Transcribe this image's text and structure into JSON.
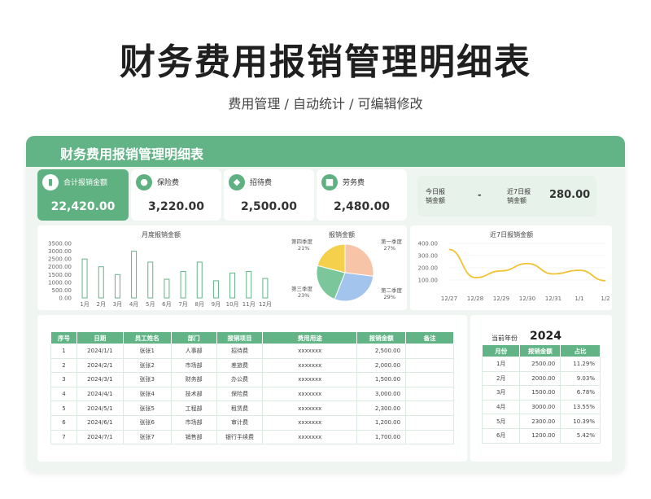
{
  "page": {
    "title": "财务费用报销管理明细表",
    "subtitle": "费用管理 / 自动统计 / 可编辑修改"
  },
  "card": {
    "title": "财务费用报销管理明细表"
  },
  "kpis": [
    {
      "label": "合计报销金额",
      "value": "22,420.00",
      "icon": "bar-chart-icon"
    },
    {
      "label": "保险费",
      "value": "3,220.00",
      "icon": "user-icon"
    },
    {
      "label": "招待费",
      "value": "2,500.00",
      "icon": "handshake-icon"
    },
    {
      "label": "劳务费",
      "value": "2,480.00",
      "icon": "document-icon"
    }
  ],
  "today": {
    "today_label": "今日报销金额",
    "today_value": "-",
    "week_label": "近7日报销金额",
    "week_value": "280.00"
  },
  "monthly_chart_title": "月度报销金额",
  "pie_chart_title": "报销金额",
  "week_chart_title": "近7日报销金额",
  "colors": {
    "accent": "#62b487",
    "pie_q1": "#f8c4a8",
    "pie_q2": "#a3c4ec",
    "pie_q3": "#7bc79b",
    "pie_q4": "#f5d04c",
    "line": "#f1c232"
  },
  "chart_data": [
    {
      "type": "bar",
      "title": "月度报销金额",
      "categories": [
        "1月",
        "2月",
        "3月",
        "4月",
        "5月",
        "6月",
        "7月",
        "8月",
        "9月",
        "10月",
        "11月",
        "12月"
      ],
      "values": [
        2500,
        2000,
        1500,
        3000,
        2300,
        1200,
        1700,
        2300,
        1100,
        1600,
        1700,
        1250
      ],
      "yticks": [
        "0.00",
        "500.00",
        "1000.00",
        "1500.00",
        "2000.00",
        "2500.00",
        "3000.00",
        "3500.00"
      ],
      "ylim": [
        0,
        3500
      ]
    },
    {
      "type": "pie",
      "title": "报销金额",
      "slices": [
        {
          "name": "第一季度",
          "percent": 27,
          "label": "27%"
        },
        {
          "name": "第二季度",
          "percent": 29,
          "label": "29%"
        },
        {
          "name": "第三季度",
          "percent": 23,
          "label": "23%"
        },
        {
          "name": "第四季度",
          "percent": 21,
          "label": "21%"
        }
      ]
    },
    {
      "type": "line",
      "title": "近7日报销金额",
      "categories": [
        "12/27",
        "12/28",
        "12/29",
        "12/30",
        "12/31",
        "1/1",
        "1/2"
      ],
      "values": [
        350,
        120,
        175,
        235,
        150,
        180,
        95
      ],
      "yticks": [
        "100.00",
        "200.00",
        "300.00",
        "400.00"
      ],
      "ylim": [
        0,
        400
      ]
    }
  ],
  "detail_table": {
    "headers": [
      "序号",
      "日期",
      "员工姓名",
      "部门",
      "报销项目",
      "费用用途",
      "报销金额",
      "备注"
    ],
    "rows": [
      [
        "1",
        "2024/1/1",
        "张张1",
        "人事部",
        "招待费",
        "xxxxxxx",
        "2,500.00",
        ""
      ],
      [
        "2",
        "2024/2/1",
        "张张2",
        "市场部",
        "差旅费",
        "xxxxxxx",
        "2,000.00",
        ""
      ],
      [
        "3",
        "2024/3/1",
        "张张3",
        "财务部",
        "办公费",
        "xxxxxxx",
        "1,500.00",
        ""
      ],
      [
        "4",
        "2024/4/1",
        "张张4",
        "技术部",
        "保险费",
        "xxxxxxx",
        "3,000.00",
        ""
      ],
      [
        "5",
        "2024/5/1",
        "张张5",
        "工程部",
        "租赁费",
        "xxxxxxx",
        "2,300.00",
        ""
      ],
      [
        "6",
        "2024/6/1",
        "张张6",
        "市场部",
        "审计费",
        "xxxxxxx",
        "1,200.00",
        ""
      ],
      [
        "7",
        "2024/7/1",
        "张张7",
        "销售部",
        "银行手续费",
        "xxxxxxx",
        "1,700.00",
        ""
      ]
    ]
  },
  "year": {
    "label": "当前年份",
    "value": "2024"
  },
  "month_table": {
    "headers": [
      "月份",
      "报销金额",
      "占比"
    ],
    "rows": [
      [
        "1月",
        "2500.00",
        "11.29%"
      ],
      [
        "2月",
        "2000.00",
        "9.03%"
      ],
      [
        "3月",
        "1500.00",
        "6.78%"
      ],
      [
        "4月",
        "3000.00",
        "13.55%"
      ],
      [
        "5月",
        "2300.00",
        "10.39%"
      ],
      [
        "6月",
        "1200.00",
        "5.42%"
      ]
    ]
  }
}
